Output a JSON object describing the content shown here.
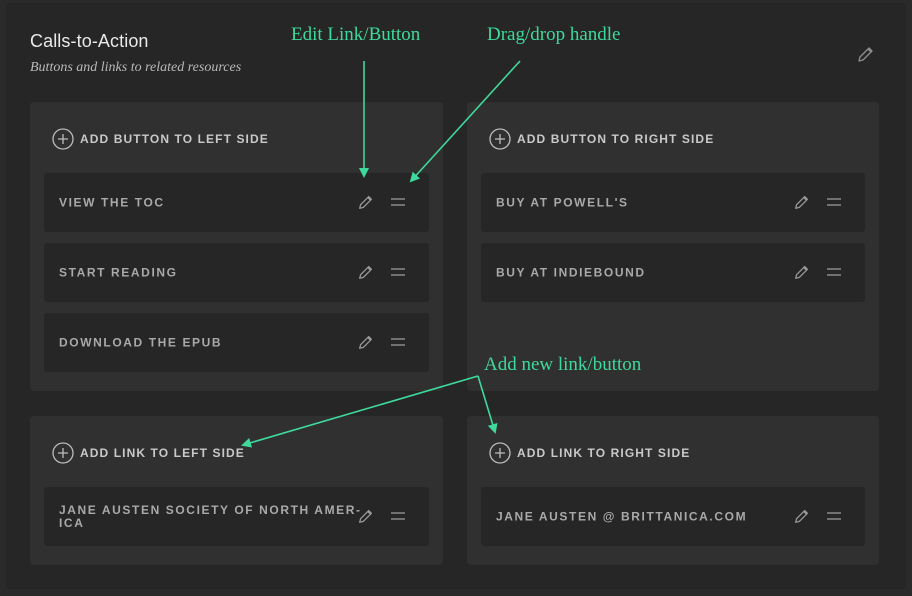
{
  "section": {
    "title": "Calls-to-Action",
    "subtitle": "Buttons and links to related resources"
  },
  "buttons": {
    "left": {
      "add_label": "ADD BUTTON TO LEFT SIDE",
      "items": [
        {
          "label": "VIEW THE TOC"
        },
        {
          "label": "START READING"
        },
        {
          "label": "DOWNLOAD THE EPUB"
        }
      ]
    },
    "right": {
      "add_label": "ADD BUTTON TO RIGHT SIDE",
      "items": [
        {
          "label": "BUY AT POWELL'S"
        },
        {
          "label": "BUY AT INDIEBOUND"
        }
      ]
    }
  },
  "links": {
    "left": {
      "add_label": "ADD LINK TO LEFT SIDE",
      "items": [
        {
          "label_line1": "JANE AUSTEN SOCIETY OF NORTH AMER-",
          "label_line2": "ICA"
        }
      ]
    },
    "right": {
      "add_label": "ADD LINK TO RIGHT SIDE",
      "items": [
        {
          "label": "JANE AUSTEN @ BRITTANICA.COM"
        }
      ]
    }
  },
  "annotations": {
    "edit": "Edit Link/Button",
    "drag": "Drag/drop handle",
    "add": "Add new link/button"
  },
  "icons": {
    "edit": "pencil-icon",
    "drag": "drag-handle-icon",
    "add": "plus-circle-icon"
  },
  "colors": {
    "annotation": "#3ed99c",
    "background": "#262626",
    "box": "#303030",
    "item": "#262626",
    "text": "#a9a9a9"
  }
}
